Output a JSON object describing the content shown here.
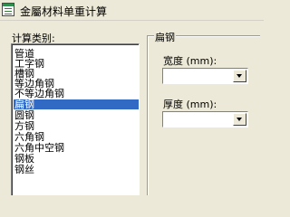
{
  "window": {
    "title": "金屬材料单重计算"
  },
  "left_panel": {
    "label": "计算类别:",
    "items": [
      "管道",
      "工字钢",
      "槽钢",
      "等边角钢",
      "不等边角钢",
      "扁钢",
      "圆钢",
      "方钢",
      "六角钢",
      "六角中空钢",
      "钢板",
      "钢丝"
    ],
    "selected_index": 5
  },
  "right_panel": {
    "group_title": "扁钢",
    "width_label": "宽度 (mm):",
    "width_value": "",
    "thickness_label": "厚度 (mm):",
    "thickness_value": ""
  },
  "colors": {
    "window_bg": "#ece9d8",
    "selection": "#316ac5",
    "icon_green": "#2f8f4f"
  }
}
